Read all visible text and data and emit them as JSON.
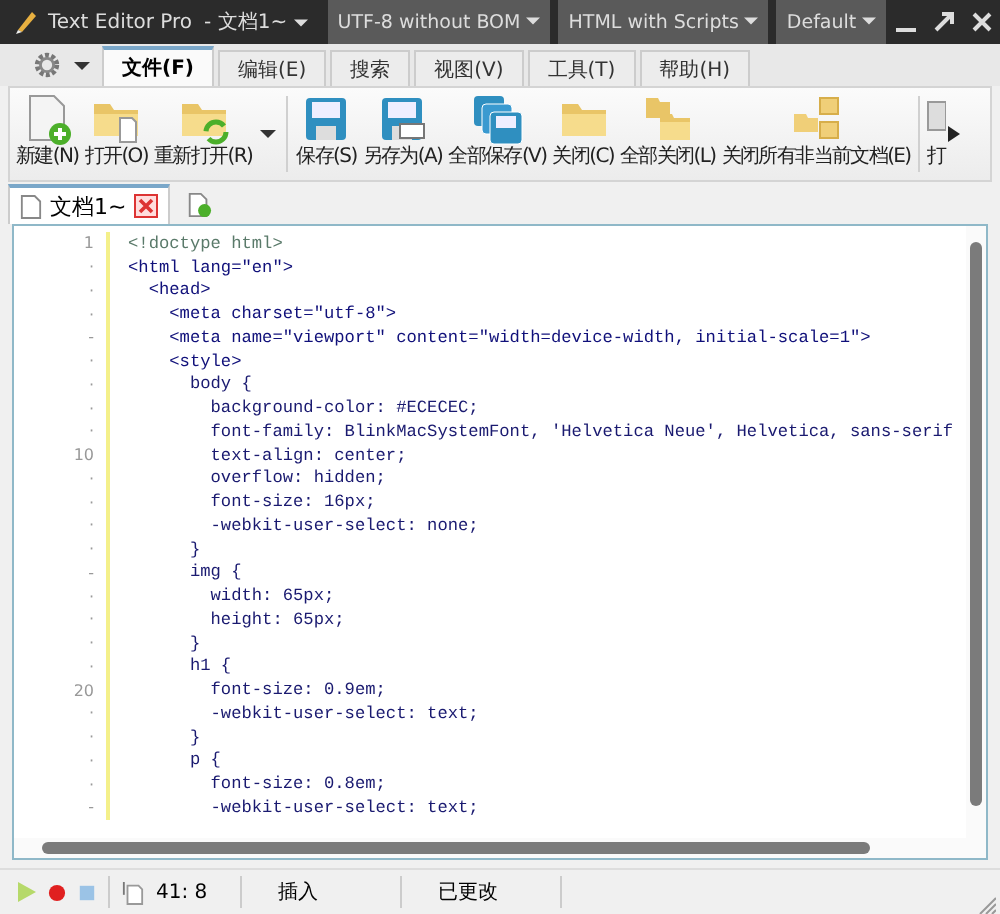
{
  "window": {
    "app_name": "Text Editor Pro",
    "document": "- 文档1~",
    "dropdowns": [
      "UTF-8 without BOM",
      "HTML with Scripts",
      "Default"
    ]
  },
  "tabs": [
    {
      "label": "文件(F)",
      "selected": true
    },
    {
      "label": "编辑(E)",
      "selected": false
    },
    {
      "label": "搜索",
      "selected": false
    },
    {
      "label": "视图(V)",
      "selected": false
    },
    {
      "label": "工具(T)",
      "selected": false
    },
    {
      "label": "帮助(H)",
      "selected": false
    }
  ],
  "ribbon": [
    {
      "kind": "new",
      "label": "新建(N)"
    },
    {
      "kind": "open",
      "label": "打开(O)"
    },
    {
      "kind": "reopen",
      "label": "重新打开(R)"
    },
    {
      "kind": "dropdown"
    },
    {
      "kind": "separator"
    },
    {
      "kind": "save",
      "label": "保存(S)"
    },
    {
      "kind": "saveas",
      "label": "另存为(A)"
    },
    {
      "kind": "saveall",
      "label": "全部保存(V)"
    },
    {
      "kind": "close",
      "label": "关闭(C)"
    },
    {
      "kind": "closeall",
      "label": "全部关闭(L)"
    },
    {
      "kind": "closeothers",
      "label": "关闭所有非当前文档(E)"
    },
    {
      "kind": "separator"
    },
    {
      "kind": "print",
      "label": "打"
    }
  ],
  "documents": [
    {
      "title": "文档1~",
      "selected": true
    }
  ],
  "code_lines": [
    {
      "gutter": "1",
      "kind": "doctype",
      "text": "<!doctype html>"
    },
    {
      "gutter": "·",
      "kind": "tag",
      "text": "<html lang=\"en\">"
    },
    {
      "gutter": "·",
      "kind": "tag",
      "text": "  <head>"
    },
    {
      "gutter": "·",
      "kind": "tag",
      "text": "    <meta charset=\"utf-8\">"
    },
    {
      "gutter": "-",
      "kind": "tag",
      "text": "    <meta name=\"viewport\" content=\"width=device-width, initial-scale=1\">"
    },
    {
      "gutter": "·",
      "kind": "tag",
      "text": "    <style>"
    },
    {
      "gutter": "·",
      "kind": "css",
      "text": "      body {"
    },
    {
      "gutter": "·",
      "kind": "css",
      "text": "        background-color: #ECECEC;"
    },
    {
      "gutter": "·",
      "kind": "css",
      "text": "        font-family: BlinkMacSystemFont, 'Helvetica Neue', Helvetica, sans-serif"
    },
    {
      "gutter": "10",
      "kind": "css",
      "text": "        text-align: center;"
    },
    {
      "gutter": "·",
      "kind": "css",
      "text": "        overflow: hidden;"
    },
    {
      "gutter": "·",
      "kind": "css",
      "text": "        font-size: 16px;"
    },
    {
      "gutter": "·",
      "kind": "css",
      "text": "        -webkit-user-select: none;"
    },
    {
      "gutter": "·",
      "kind": "css",
      "text": "      }"
    },
    {
      "gutter": "-",
      "kind": "css",
      "text": "      img {"
    },
    {
      "gutter": "·",
      "kind": "css",
      "text": "        width: 65px;"
    },
    {
      "gutter": "·",
      "kind": "css",
      "text": "        height: 65px;"
    },
    {
      "gutter": "·",
      "kind": "css",
      "text": "      }"
    },
    {
      "gutter": "·",
      "kind": "css",
      "text": "      h1 {"
    },
    {
      "gutter": "20",
      "kind": "css",
      "text": "        font-size: 0.9em;"
    },
    {
      "gutter": "·",
      "kind": "css",
      "text": "        -webkit-user-select: text;"
    },
    {
      "gutter": "·",
      "kind": "css",
      "text": "      }"
    },
    {
      "gutter": "·",
      "kind": "css",
      "text": "      p {"
    },
    {
      "gutter": "·",
      "kind": "css",
      "text": "        font-size: 0.8em;"
    },
    {
      "gutter": "-",
      "kind": "css",
      "text": "        -webkit-user-select: text;"
    }
  ],
  "status_bar": {
    "position": "41: 8",
    "mode": "插入",
    "state": "已更改"
  }
}
